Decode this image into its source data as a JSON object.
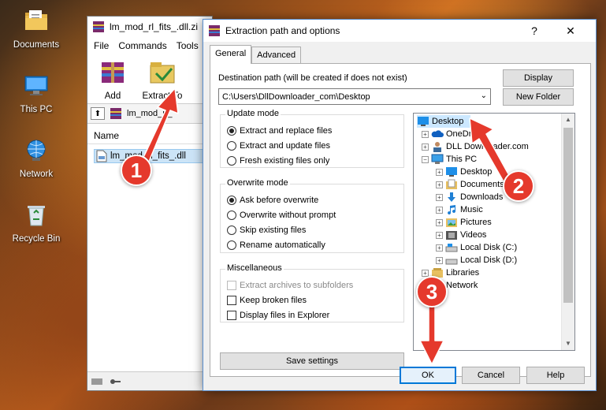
{
  "desktop": {
    "icons": [
      {
        "label": "Documents"
      },
      {
        "label": "This PC"
      },
      {
        "label": "Network"
      },
      {
        "label": "Recycle Bin"
      }
    ]
  },
  "winrar": {
    "title": "lm_mod_rl_fits_.dll.zi",
    "menu": [
      "File",
      "Commands",
      "Tools"
    ],
    "tools": [
      {
        "label": "Add"
      },
      {
        "label": "Extract To"
      }
    ],
    "path": "lm_mod_rl_",
    "column_name": "Name",
    "file_row": "lm_mod_rl_fits_.dll"
  },
  "dialog": {
    "title": "Extraction path and options",
    "help": "?",
    "close": "✕",
    "tabs": [
      "General",
      "Advanced"
    ],
    "dest_label": "Destination path (will be created if does not exist)",
    "dest_value": "C:\\Users\\DllDownloader_com\\Desktop",
    "display_button": "Display",
    "new_folder_button": "New Folder",
    "update_mode": {
      "title": "Update mode",
      "options": [
        "Extract and replace files",
        "Extract and update files",
        "Fresh existing files only"
      ]
    },
    "overwrite_mode": {
      "title": "Overwrite mode",
      "options": [
        "Ask before overwrite",
        "Overwrite without prompt",
        "Skip existing files",
        "Rename automatically"
      ]
    },
    "misc": {
      "title": "Miscellaneous",
      "options": [
        "Extract archives to subfolders",
        "Keep broken files",
        "Display files in Explorer"
      ]
    },
    "save_settings": "Save settings",
    "tree": [
      {
        "label": "Desktop"
      },
      {
        "label": "OneDrive"
      },
      {
        "label": "DLL Downloader.com"
      },
      {
        "label": "This PC"
      },
      {
        "label": "Desktop"
      },
      {
        "label": "Documents"
      },
      {
        "label": "Downloads"
      },
      {
        "label": "Music"
      },
      {
        "label": "Pictures"
      },
      {
        "label": "Videos"
      },
      {
        "label": "Local Disk (C:)"
      },
      {
        "label": "Local Disk (D:)"
      },
      {
        "label": "Libraries"
      },
      {
        "label": "Network"
      }
    ],
    "ok": "OK",
    "cancel": "Cancel",
    "help_button": "Help"
  },
  "annotations": [
    "1",
    "2",
    "3"
  ],
  "colors": {
    "annotation": "#e5392c",
    "selection": "#cce8ff",
    "focus": "#0078d7"
  }
}
